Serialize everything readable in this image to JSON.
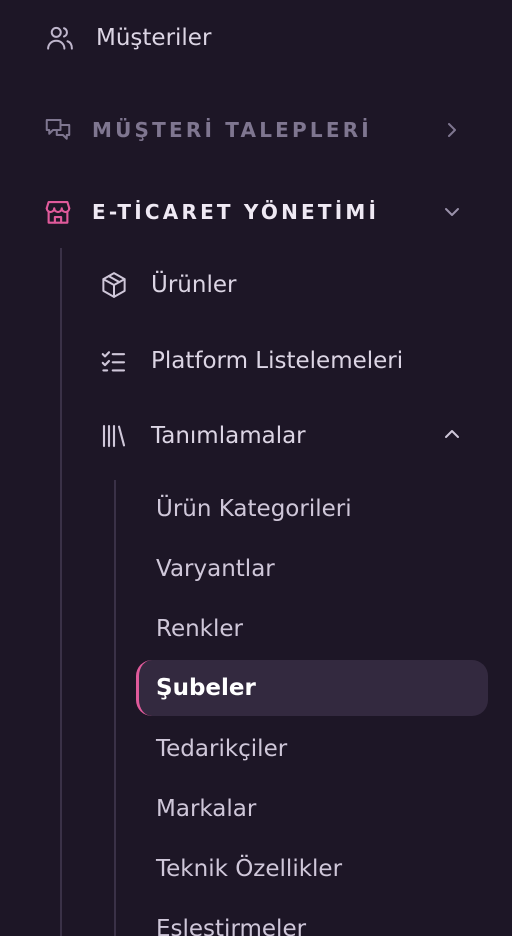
{
  "nav": {
    "customers": {
      "label": "Müşteriler",
      "icon": "users-icon"
    },
    "customer_requests": {
      "label": "MÜŞTERİ TALEPLERİ",
      "icon": "chat-icon",
      "expanded": false
    },
    "ecommerce": {
      "label": "E-TİCARET YÖNETİMİ",
      "icon": "store-icon",
      "icon_color": "#e05a9b",
      "expanded": true,
      "items": [
        {
          "label": "Ürünler",
          "icon": "box-icon"
        },
        {
          "label": "Platform Listelemeleri",
          "icon": "checklist-icon"
        },
        {
          "label": "Tanımlamalar",
          "icon": "library-icon",
          "expanded": true,
          "children": [
            {
              "label": "Ürün Kategorileri"
            },
            {
              "label": "Varyantlar"
            },
            {
              "label": "Renkler"
            },
            {
              "label": "Şubeler",
              "active": true
            },
            {
              "label": "Tedarikçiler"
            },
            {
              "label": "Markalar"
            },
            {
              "label": "Teknik Özellikler"
            },
            {
              "label": "Eşleştirmeler"
            }
          ]
        }
      ]
    }
  },
  "colors": {
    "background": "#1d1626",
    "accent": "#e05a9b",
    "active_bg": "#33293f",
    "muted_text": "#7f7690",
    "text": "#dcd5e4"
  }
}
